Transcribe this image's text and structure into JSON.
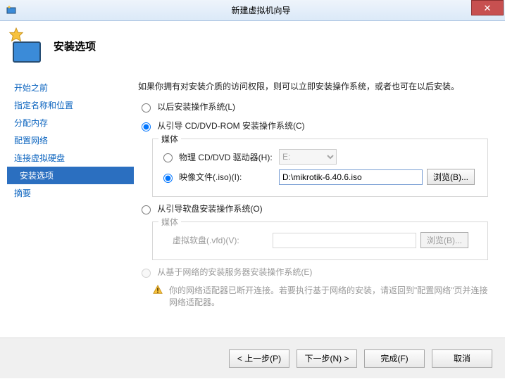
{
  "window": {
    "title": "新建虚拟机向导",
    "close_glyph": "✕"
  },
  "header": {
    "title": "安装选项"
  },
  "sidebar": {
    "items": [
      {
        "label": "开始之前"
      },
      {
        "label": "指定名称和位置"
      },
      {
        "label": "分配内存"
      },
      {
        "label": "配置网络"
      },
      {
        "label": "连接虚拟硬盘"
      },
      {
        "label": "安装选项"
      },
      {
        "label": "摘要"
      }
    ],
    "selected_index": 5
  },
  "content": {
    "intro": "如果你拥有对安装介质的访问权限，则可以立即安装操作系统，或者也可在以后安装。",
    "options": {
      "later": "以后安装操作系统(L)",
      "cd": "从引导 CD/DVD-ROM 安装操作系统(C)",
      "floppy": "从引导软盘安装操作系统(O)",
      "net": "从基于网络的安装服务器安装操作系统(E)",
      "selected": "cd"
    },
    "media_cd": {
      "legend": "媒体",
      "phys_label": "物理 CD/DVD 驱动器(H):",
      "phys_value": "E:",
      "iso_label": "映像文件(.iso)(I):",
      "iso_value": "D:\\mikrotik-6.40.6.iso",
      "browse": "浏览(B)...",
      "selected": "iso"
    },
    "media_floppy": {
      "legend": "媒体",
      "vfd_label": "虚拟软盘(.vfd)(V):",
      "vfd_value": "",
      "browse": "浏览(B)..."
    },
    "net_warn": "你的网络适配器已断开连接。若要执行基于网络的安装，请返回到\"配置网络\"页并连接网络适配器。"
  },
  "footer": {
    "prev": "< 上一步(P)",
    "next": "下一步(N) >",
    "finish": "完成(F)",
    "cancel": "取消"
  }
}
